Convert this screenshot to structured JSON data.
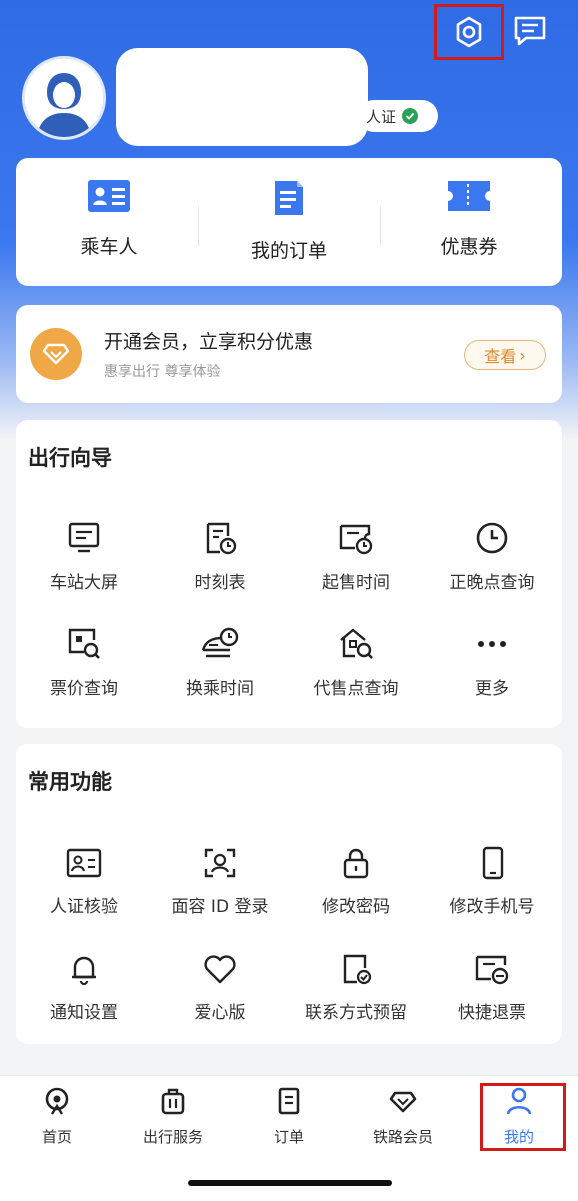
{
  "header": {
    "verify_text": "人证",
    "icons": [
      "settings-icon",
      "message-icon",
      "avatar"
    ]
  },
  "quick_menu": [
    {
      "label": "乘车人",
      "icon": "passenger-card-icon"
    },
    {
      "label": "我的订单",
      "icon": "order-doc-icon"
    },
    {
      "label": "优惠券",
      "icon": "coupon-icon"
    }
  ],
  "vip": {
    "title": "开通会员，立享积分优惠",
    "subtitle": "惠享出行 尊享体验",
    "button": "查看",
    "button_arrow": "›"
  },
  "travel_guide": {
    "title": "出行向导",
    "items": [
      {
        "label": "车站大屏",
        "icon": "station-screen-icon"
      },
      {
        "label": "时刻表",
        "icon": "timetable-icon"
      },
      {
        "label": "起售时间",
        "icon": "sale-time-icon"
      },
      {
        "label": "正晚点查询",
        "icon": "clock-icon"
      },
      {
        "label": "票价查询",
        "icon": "fare-search-icon"
      },
      {
        "label": "换乘时间",
        "icon": "transfer-time-icon"
      },
      {
        "label": "代售点查询",
        "icon": "agency-search-icon"
      },
      {
        "label": "更多",
        "icon": "more-icon"
      }
    ]
  },
  "common_functions": {
    "title": "常用功能",
    "items": [
      {
        "label": "人证核验",
        "icon": "id-verify-icon"
      },
      {
        "label": "面容 ID 登录",
        "icon": "face-id-icon"
      },
      {
        "label": "修改密码",
        "icon": "lock-icon"
      },
      {
        "label": "修改手机号",
        "icon": "phone-icon"
      },
      {
        "label": "通知设置",
        "icon": "bell-icon"
      },
      {
        "label": "爱心版",
        "icon": "heart-icon"
      },
      {
        "label": "联系方式预留",
        "icon": "contact-reserve-icon"
      },
      {
        "label": "快捷退票",
        "icon": "quick-refund-icon"
      }
    ]
  },
  "tabbar": [
    {
      "label": "首页",
      "icon": "home-icon"
    },
    {
      "label": "出行服务",
      "icon": "luggage-icon"
    },
    {
      "label": "订单",
      "icon": "order-icon"
    },
    {
      "label": "铁路会员",
      "icon": "diamond-icon"
    },
    {
      "label": "我的",
      "icon": "user-icon",
      "active": true
    }
  ],
  "colors": {
    "primary": "#3b78ef",
    "highlight_box": "#d11a1a",
    "vip_gold": "#f0a745"
  }
}
